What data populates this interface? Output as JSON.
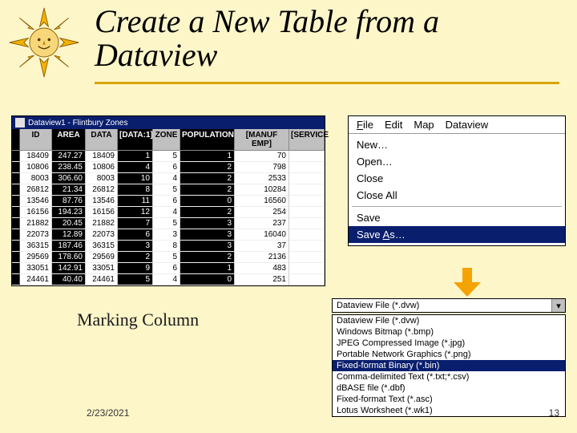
{
  "title": "Create a New Table from a Dataview",
  "table": {
    "window_title": "Dataview1 - Flintbury Zones",
    "columns": [
      "ID",
      "AREA",
      "DATA",
      "[DATA:1]",
      "ZONE",
      "POPULATION",
      "[MANUF EMP]",
      "[SERVICE"
    ],
    "rows": [
      [
        "18409",
        "247.27",
        "18409",
        "1",
        "5",
        "1",
        "70"
      ],
      [
        "10806",
        "238.45",
        "10806",
        "4",
        "6",
        "2",
        "798"
      ],
      [
        "8003",
        "306.60",
        "8003",
        "10",
        "4",
        "2",
        "2533"
      ],
      [
        "26812",
        "21.34",
        "26812",
        "8",
        "5",
        "2",
        "10284"
      ],
      [
        "13546",
        "87.76",
        "13546",
        "11",
        "6",
        "0",
        "16560"
      ],
      [
        "16156",
        "194.23",
        "16156",
        "12",
        "4",
        "2",
        "254"
      ],
      [
        "21882",
        "20.45",
        "21882",
        "7",
        "5",
        "3",
        "237"
      ],
      [
        "22073",
        "12.89",
        "22073",
        "6",
        "3",
        "3",
        "16040"
      ],
      [
        "36315",
        "187.46",
        "36315",
        "3",
        "8",
        "3",
        "37"
      ],
      [
        "29569",
        "178.60",
        "29569",
        "2",
        "5",
        "2",
        "2136"
      ],
      [
        "33051",
        "142.91",
        "33051",
        "9",
        "6",
        "1",
        "483"
      ],
      [
        "24461",
        "40.40",
        "24461",
        "5",
        "4",
        "0",
        "251"
      ]
    ]
  },
  "marking_label": "Marking Column",
  "menubar": {
    "file": "File",
    "edit": "Edit",
    "map": "Map",
    "dataview": "Dataview"
  },
  "file_menu": {
    "new": "New…",
    "open": "Open…",
    "close": "Close",
    "close_all": "Close All",
    "save": "Save",
    "save_as": "Save As…"
  },
  "dropdown_selected": "Dataview File (*.dvw)",
  "file_types": [
    "Dataview File (*.dvw)",
    "Windows Bitmap (*.bmp)",
    "JPEG Compressed Image (*.jpg)",
    "Portable Network Graphics (*.png)",
    "Fixed-format Binary (*.bin)",
    "Comma-delimited Text (*.txt;*.csv)",
    "dBASE file (*.dbf)",
    "Fixed-format Text (*.asc)",
    "Lotus Worksheet (*.wk1)"
  ],
  "file_type_selected_index": 4,
  "date": "2/23/2021",
  "page_number": "13"
}
